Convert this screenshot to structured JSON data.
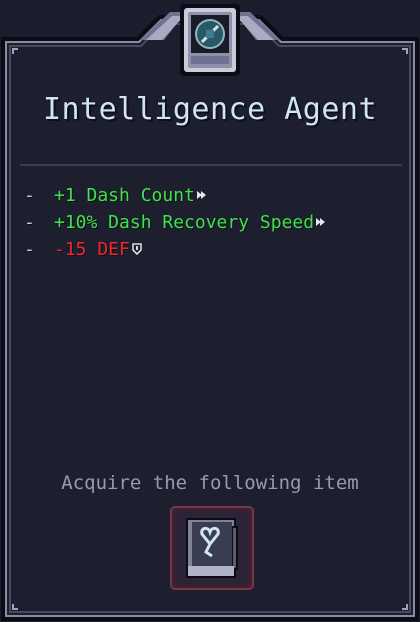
{
  "card": {
    "title": "Intelligence Agent",
    "emblem_icon": "compass-emblem-icon",
    "stats": [
      {
        "bullet": "-",
        "text": "+1 Dash Count",
        "kind": "positive",
        "icon": "dash-arrow-icon"
      },
      {
        "bullet": "-",
        "text": "+10% Dash Recovery Speed",
        "kind": "positive",
        "icon": "dash-arrow-icon"
      },
      {
        "bullet": "-",
        "text": "-15 DEF",
        "kind": "negative",
        "icon": "shield-icon"
      }
    ],
    "acquire_label": "Acquire the following item",
    "item_icon": "heart-notebook-icon"
  },
  "colors": {
    "background": "#1b1c2c",
    "border": "#6b6e86",
    "title": "#cfe6f0",
    "positive": "#3fe24a",
    "negative": "#f0262e",
    "muted": "#9a9aab"
  }
}
